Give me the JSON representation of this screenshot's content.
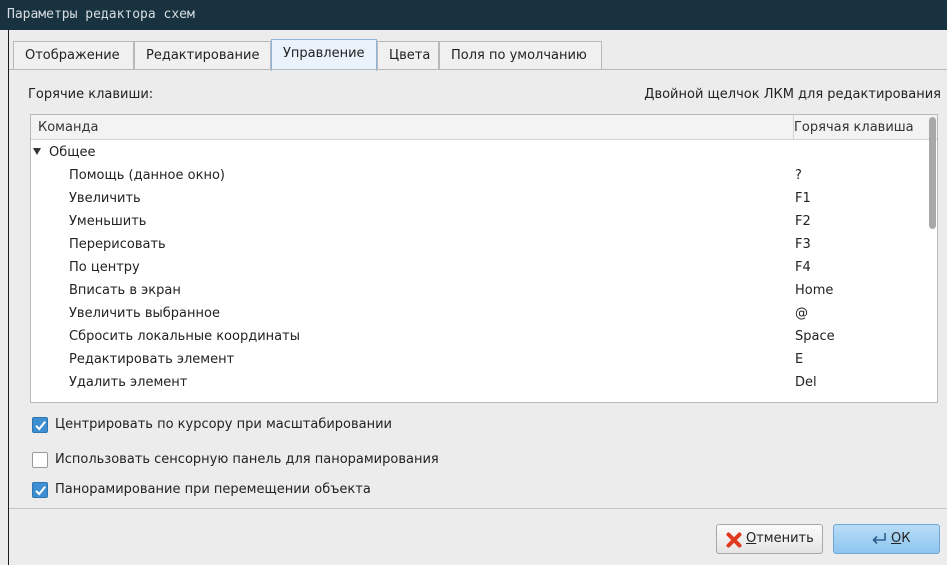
{
  "window": {
    "title": "Параметры редактора схем"
  },
  "tabs": [
    {
      "label": "Отображение",
      "active": false
    },
    {
      "label": "Редактирование",
      "active": false
    },
    {
      "label": "Управление",
      "active": true
    },
    {
      "label": "Цвета",
      "active": false
    },
    {
      "label": "Поля по умолчанию",
      "active": false
    }
  ],
  "hotkeys": {
    "label": "Горячие клавиши:",
    "hint": "Двойной щелчок ЛКМ для редактирования",
    "columns": {
      "command": "Команда",
      "hotkey": "Горячая клавиша"
    },
    "group": {
      "name": "Общее",
      "expanded": true
    },
    "rows": [
      {
        "command": "Помощь (данное окно)",
        "key": "?"
      },
      {
        "command": "Увеличить",
        "key": "F1"
      },
      {
        "command": "Уменьшить",
        "key": "F2"
      },
      {
        "command": "Перерисовать",
        "key": "F3"
      },
      {
        "command": "По центру",
        "key": "F4"
      },
      {
        "command": "Вписать в экран",
        "key": "Home"
      },
      {
        "command": "Увеличить выбранное",
        "key": "@"
      },
      {
        "command": "Сбросить локальные координаты",
        "key": "Space"
      },
      {
        "command": "Редактировать элемент",
        "key": "E"
      },
      {
        "command": "Удалить элемент",
        "key": "Del"
      }
    ]
  },
  "options": [
    {
      "label": "Центрировать по курсору при масштабировании",
      "checked": true
    },
    {
      "label": "Использовать сенсорную панель для панорамирования",
      "checked": false
    },
    {
      "label": "Панорамирование при перемещении объекта",
      "checked": true
    }
  ],
  "buttons": {
    "cancel": {
      "mnemonic": "О",
      "rest": "тменить",
      "icon": "cancel-x-icon"
    },
    "ok": {
      "mnemonic": "О",
      "rest": "К",
      "icon": "enter-arrow-icon"
    }
  },
  "colors": {
    "accent": "#3d8fd1",
    "titlebar": "#19323f",
    "cancel_icon": "#e03a1e"
  }
}
